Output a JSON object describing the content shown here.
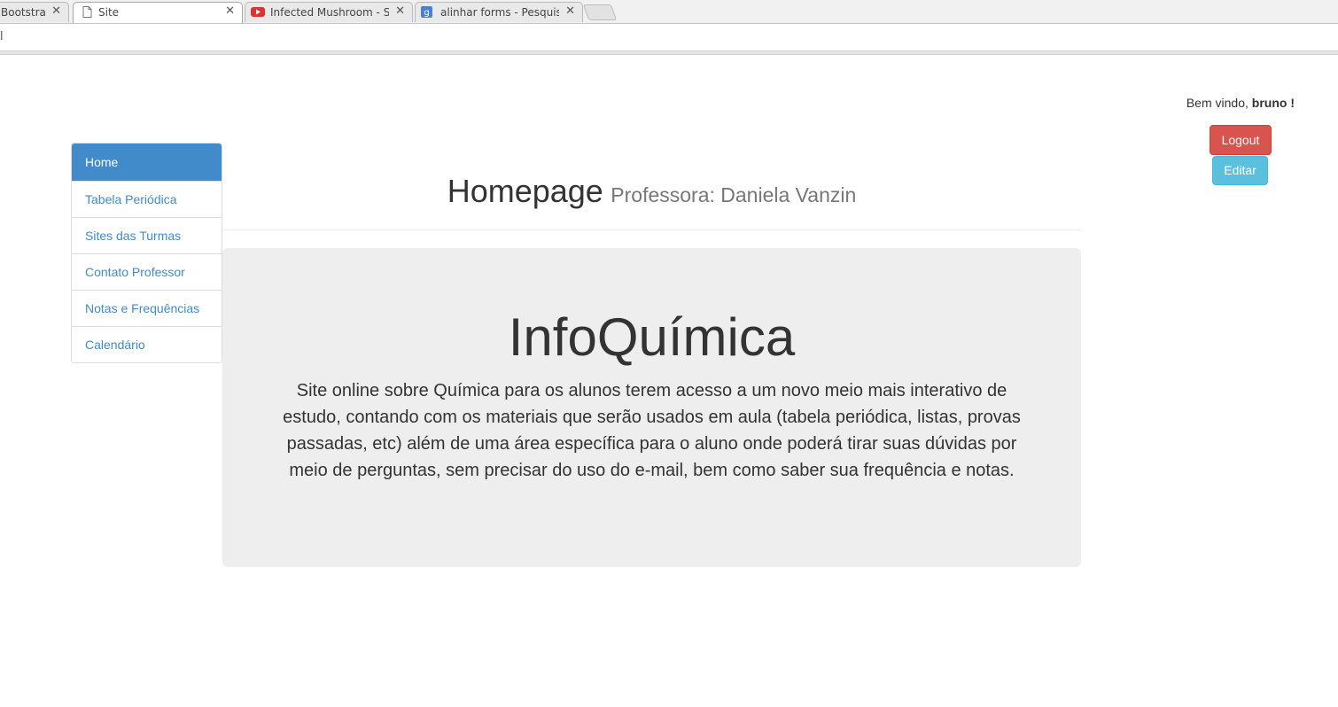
{
  "browser": {
    "tabs": [
      {
        "title": "Bootstrap",
        "icon": "page-icon",
        "active": false
      },
      {
        "title": "Site",
        "icon": "page-icon",
        "active": true
      },
      {
        "title": "Infected Mushroom - Saeed",
        "icon": "youtube-icon",
        "active": false
      },
      {
        "title": "alinhar forms - Pesquisa Google",
        "icon": "google-icon",
        "active": false
      }
    ],
    "close_glyph": "✕",
    "url": "l"
  },
  "header": {
    "welcome_prefix": "Bem vindo, ",
    "username": "bruno !",
    "logout_label": "Logout",
    "edit_label": "Editar"
  },
  "sidebar": {
    "items": [
      {
        "label": "Home",
        "active": true
      },
      {
        "label": "Tabela Periódica",
        "active": false
      },
      {
        "label": "Sites das Turmas",
        "active": false
      },
      {
        "label": "Contato Professor",
        "active": false
      },
      {
        "label": "Notas e Frequências",
        "active": false
      },
      {
        "label": "Calendário",
        "active": false
      }
    ]
  },
  "main": {
    "title": "Homepage",
    "subtitle": "Professora: Daniela Vanzin",
    "jumbotron": {
      "heading": "InfoQuímica",
      "text": "Site online sobre Química para os alunos terem acesso a um novo meio mais interativo de estudo, contando com os materiais que serão usados em aula (tabela periódica, listas, provas passadas, etc) além de uma área específica para o aluno onde poderá tirar suas dúvidas por meio de perguntas, sem precisar do uso do e-mail, bem como saber sua frequência e notas."
    }
  },
  "colors": {
    "primary": "#428bca",
    "danger": "#d9534f",
    "info": "#5bc0de",
    "jumbotron_bg": "#eeeeee"
  }
}
